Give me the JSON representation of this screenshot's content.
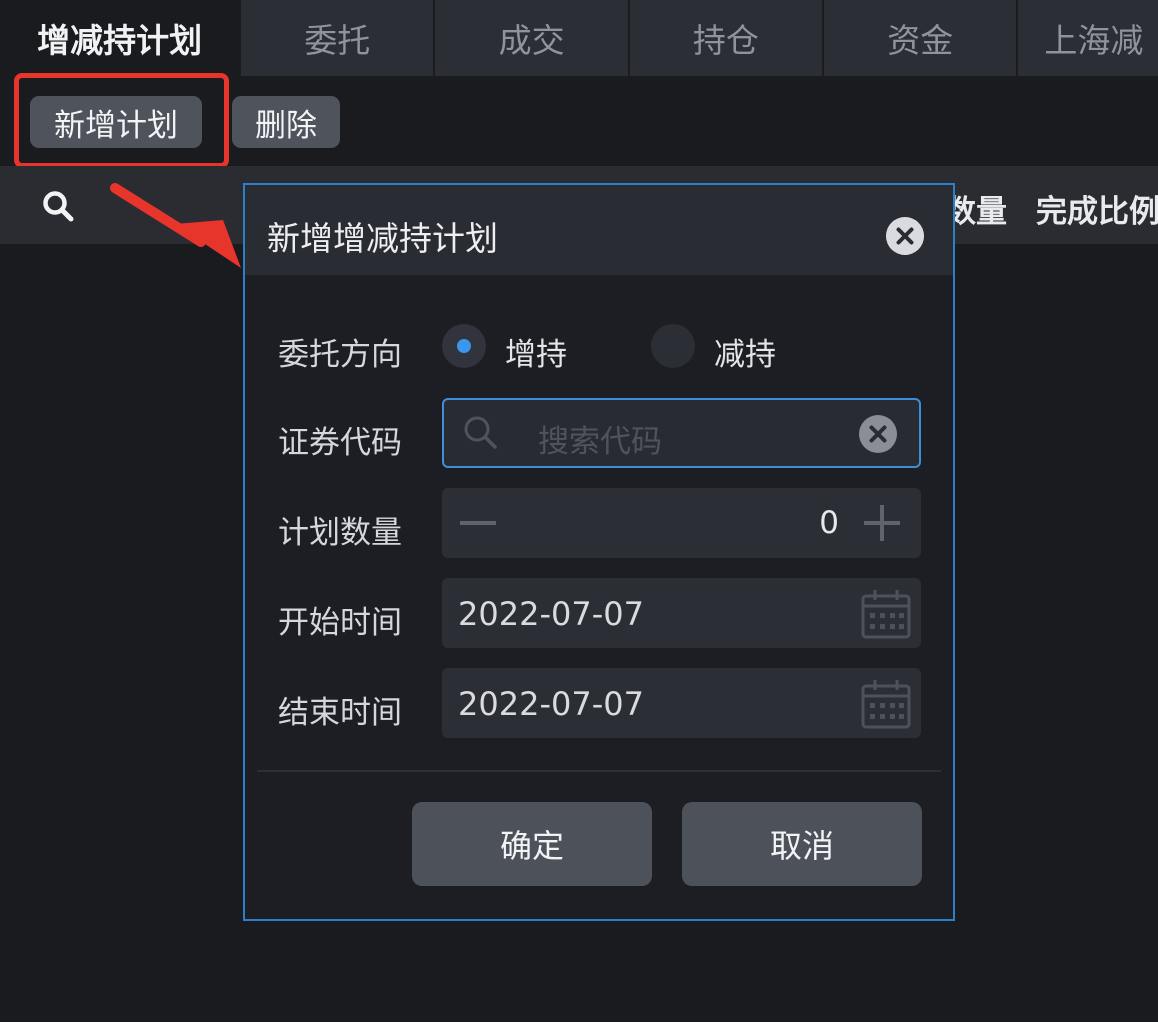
{
  "tabs": [
    {
      "label": "增减持计划"
    },
    {
      "label": "委托"
    },
    {
      "label": "成交"
    },
    {
      "label": "持仓"
    },
    {
      "label": "资金"
    },
    {
      "label": "上海减"
    }
  ],
  "toolbar": {
    "add_label": "新增计划",
    "delete_label": "删除"
  },
  "table_header": {
    "columns": [
      {
        "label": "数量"
      },
      {
        "label": "完成比例"
      }
    ]
  },
  "dialog": {
    "title": "新增增减持计划",
    "direction": {
      "label": "委托方向",
      "options": [
        {
          "label": "增持",
          "selected": true
        },
        {
          "label": "减持",
          "selected": false
        }
      ]
    },
    "code": {
      "label": "证券代码",
      "placeholder": "搜索代码"
    },
    "quantity": {
      "label": "计划数量",
      "value": "0"
    },
    "start": {
      "label": "开始时间",
      "value": "2022-07-07"
    },
    "end": {
      "label": "结束时间",
      "value": "2022-07-07"
    },
    "ok_label": "确定",
    "cancel_label": "取消"
  },
  "colors": {
    "accent": "#3b97ee",
    "highlight": "#e8352b",
    "dialog_border": "#2d7fc9"
  },
  "icons": [
    "search-icon",
    "close-icon",
    "clear-icon",
    "minus-icon",
    "plus-icon",
    "calendar-icon",
    "arrow-annotation"
  ]
}
